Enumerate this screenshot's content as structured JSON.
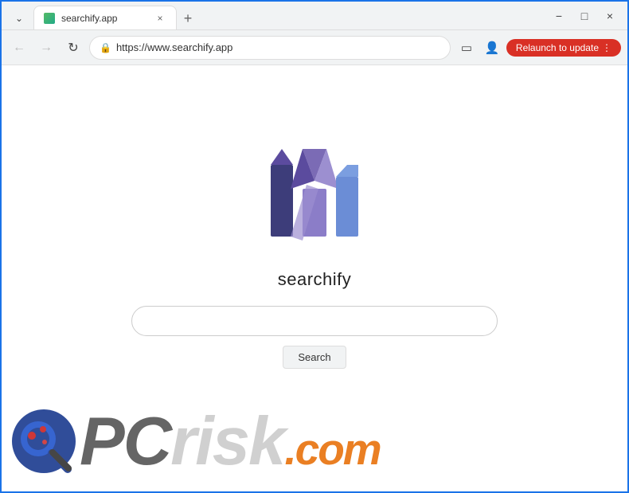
{
  "browser": {
    "tab": {
      "favicon": "🌐",
      "title": "searchify.app",
      "close_label": "×"
    },
    "new_tab_label": "+",
    "window_controls": {
      "minimize": "−",
      "maximize": "□",
      "close": "×",
      "chevron": "⌄"
    },
    "nav": {
      "back": "←",
      "forward": "→",
      "reload": "↻"
    },
    "address": {
      "lock_icon": "🔒",
      "url": "https://www.searchify.app"
    },
    "actions": {
      "cast_icon": "▭",
      "profile_icon": "👤",
      "relaunch_label": "Relaunch to update",
      "menu_dots": "⋮"
    }
  },
  "page": {
    "site_name": "searchify",
    "search_placeholder": "",
    "search_button_label": "Search"
  },
  "watermark": {
    "pc_text": "PC",
    "risk_text": "risk",
    "dotcom_text": ".com"
  }
}
